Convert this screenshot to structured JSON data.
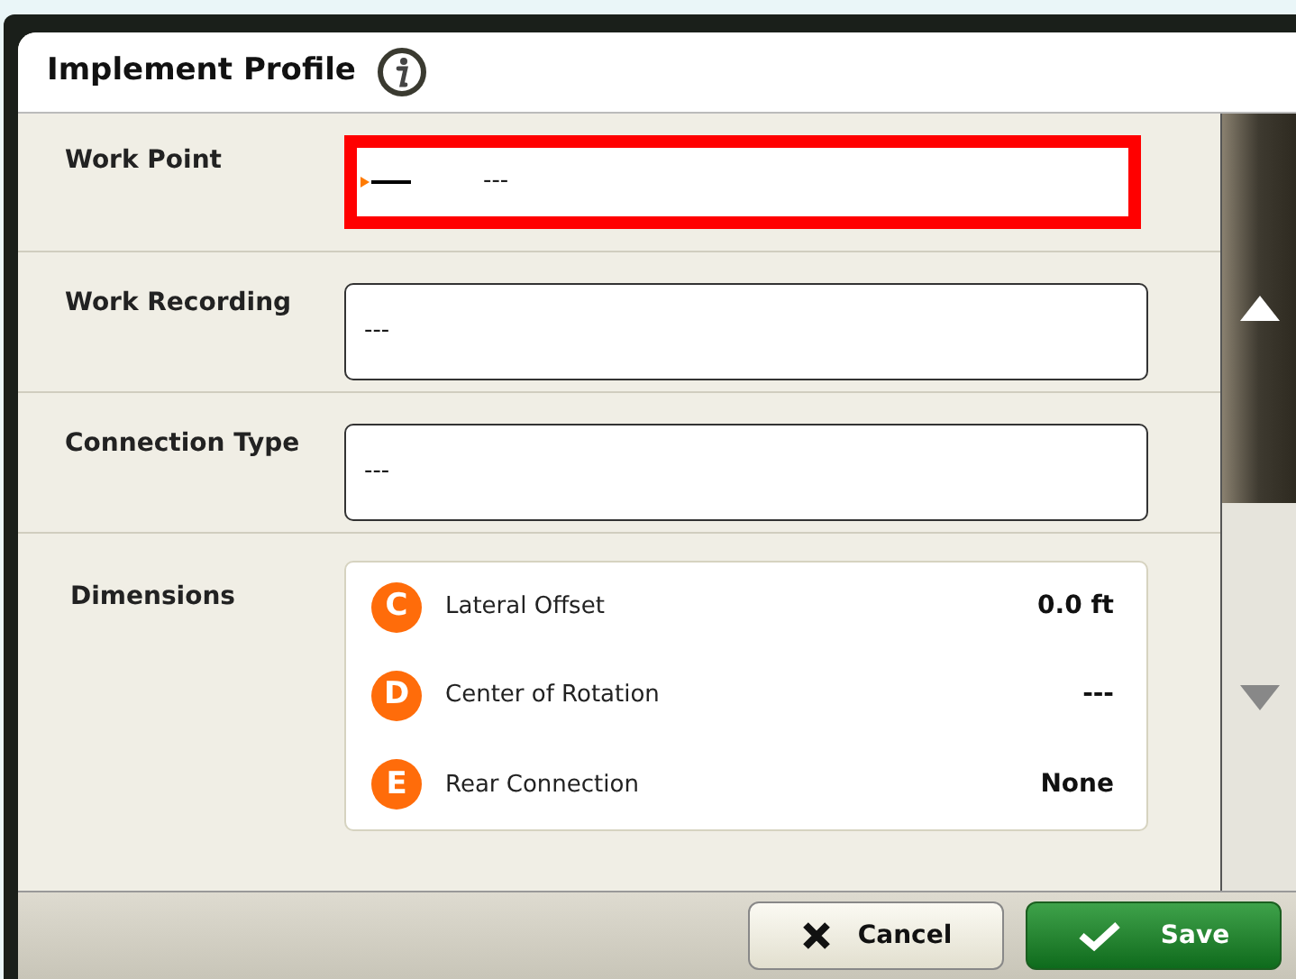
{
  "window": {
    "title": "Implement Profile"
  },
  "fields": [
    {
      "label": "Work Point",
      "value": "---",
      "focused": true
    },
    {
      "label": "Work Recording",
      "value": "---",
      "focused": false
    },
    {
      "label": "Connection Type",
      "value": "---",
      "focused": false
    }
  ],
  "dimensions": {
    "label": "Dimensions",
    "items": [
      {
        "letter": "C",
        "name": "Lateral Offset",
        "value": "0.0 ft"
      },
      {
        "letter": "D",
        "name": "Center of Rotation",
        "value": "---"
      },
      {
        "letter": "E",
        "name": "Rear Connection",
        "value": "None"
      }
    ]
  },
  "buttons": [
    {
      "kind": "cancel",
      "label": "Cancel"
    },
    {
      "kind": "save",
      "label": "Save"
    }
  ]
}
